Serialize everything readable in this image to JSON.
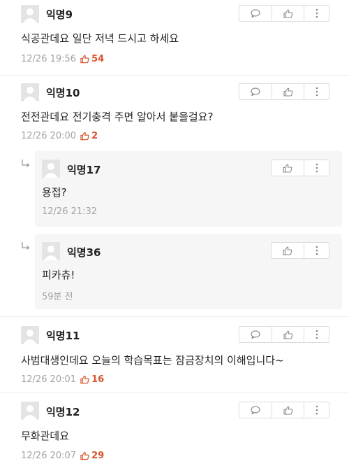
{
  "colors": {
    "accent": "#d9552f",
    "meta": "#a3a3a3",
    "reply_bg": "#f6f6f7"
  },
  "comments": [
    {
      "author": "익명9",
      "text": "식공관데요 일단 저녁 드시고 하세요",
      "time": "12/26 19:56",
      "likes": "54"
    },
    {
      "author": "익명10",
      "text": "전전관데요 전기충격 주면 알아서 붙을걸요?",
      "time": "12/26 20:00",
      "likes": "2"
    },
    {
      "author": "익명11",
      "text": "사범대생인데요 오늘의 학습목표는 잠금장치의 이해입니다~",
      "time": "12/26 20:01",
      "likes": "16"
    },
    {
      "author": "익명12",
      "text": "무화관데요",
      "time": "12/26 20:07",
      "likes": "29"
    }
  ],
  "replies": [
    {
      "author": "익명17",
      "text": "용접?",
      "time": "12/26 21:32"
    },
    {
      "author": "익명36",
      "text": "피카츄!",
      "time": "59분 전"
    }
  ],
  "icons": {
    "comment": "speech-bubble-icon",
    "like": "thumbs-up-icon",
    "more": "more-vertical-icon",
    "reply": "reply-arrow-icon",
    "avatar": "user-avatar-icon"
  }
}
